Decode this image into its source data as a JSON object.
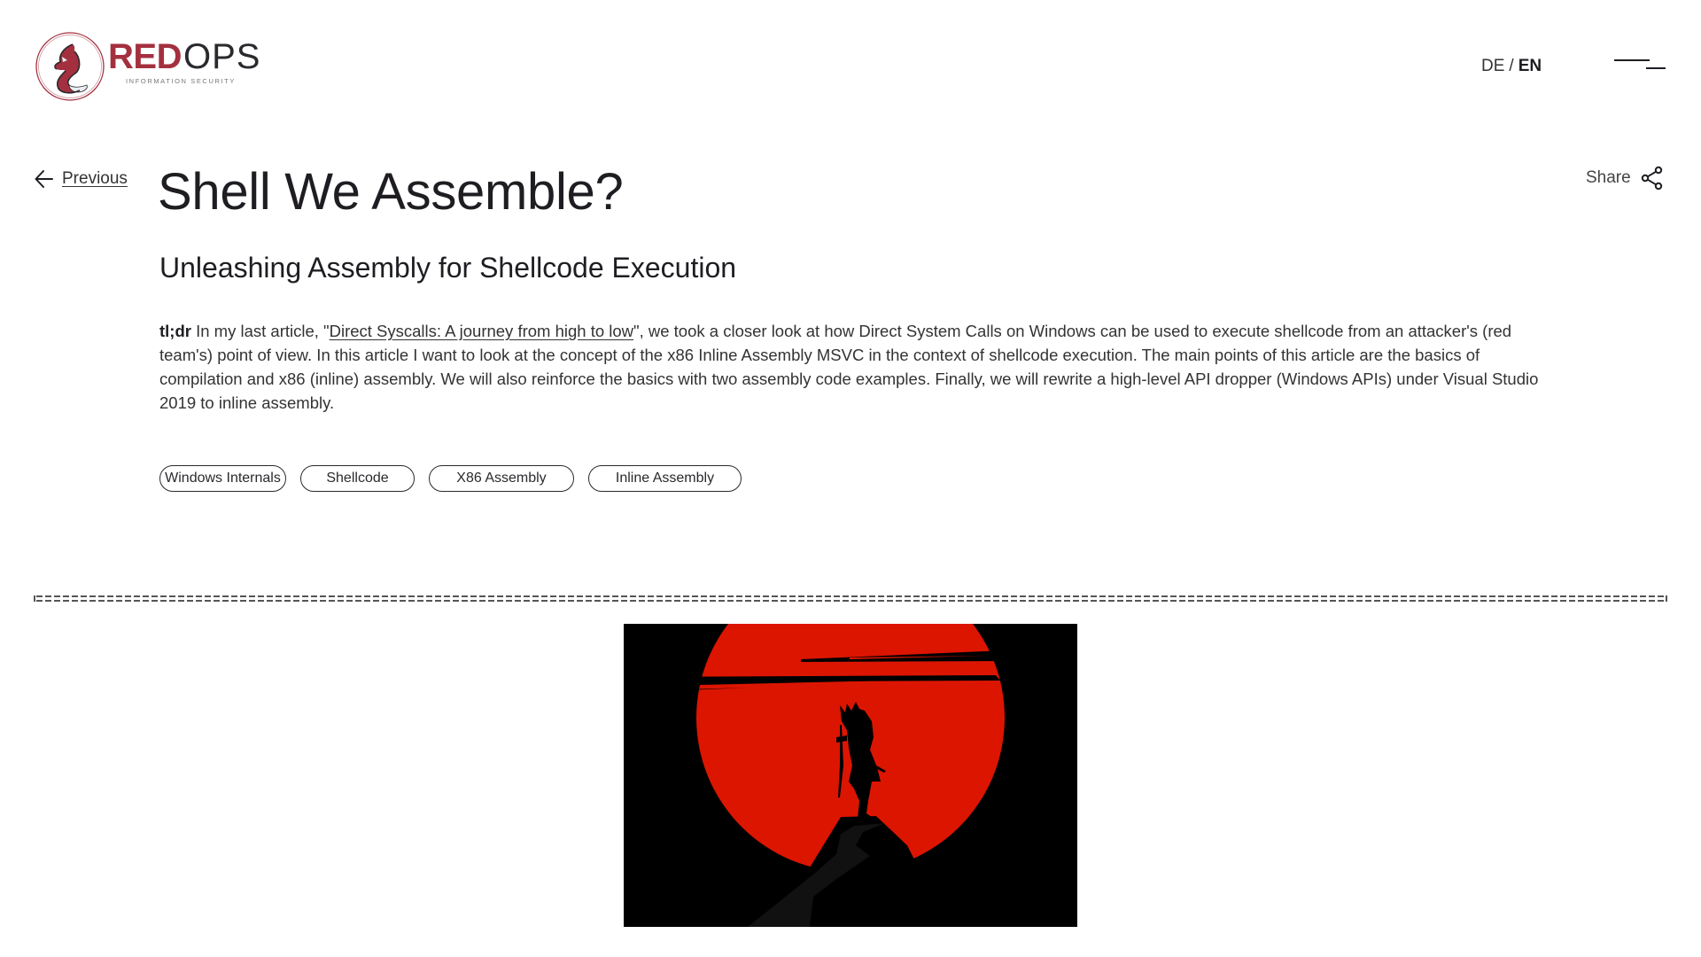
{
  "header": {
    "logo": {
      "brand_primary": "RED",
      "brand_secondary": "OPS",
      "tagline": "INFORMATION SECURITY",
      "colors": {
        "red": "#a4303f",
        "dark": "#2a2a2e"
      }
    },
    "language": {
      "options": [
        "DE",
        "EN"
      ],
      "separator": "/",
      "active": "EN"
    },
    "menu_icon": "hamburger-menu-icon"
  },
  "nav": {
    "previous_label": "Previous",
    "previous_icon": "arrow-left-icon",
    "share_label": "Share",
    "share_icon": "share-icon"
  },
  "article": {
    "title": "Shell We Assemble?",
    "subtitle": "Unleashing Assembly for Shellcode Execution",
    "intro": {
      "lead": "tl;dr",
      "text_before_link": " In my last article, \"",
      "link_text": "Direct Syscalls: A journey from high to low",
      "text_after_link": "\", we took a closer look at how Direct System Calls on Windows can be used to execute shellcode from an attacker's (red team's) point of view. In this article I want to look at the concept of the x86 Inline Assembly MSVC in the context of shellcode execution. The main points of this article are the basics of compilation and x86 (inline) assembly. We will also reinforce the basics with two assembly code examples. Finally, we will rewrite a high-level API dropper (Windows APIs) under Visual Studio 2019 to inline assembly."
    },
    "tags": [
      "Windows Internals",
      "Shellcode",
      "X86 Assembly",
      "Inline Assembly"
    ],
    "hero_image": {
      "alt": "Samurai silhouette standing on a cliff in front of a red sun",
      "colors": {
        "sun": "#dc1500",
        "background": "#000000",
        "cliff": "#111111"
      }
    }
  }
}
